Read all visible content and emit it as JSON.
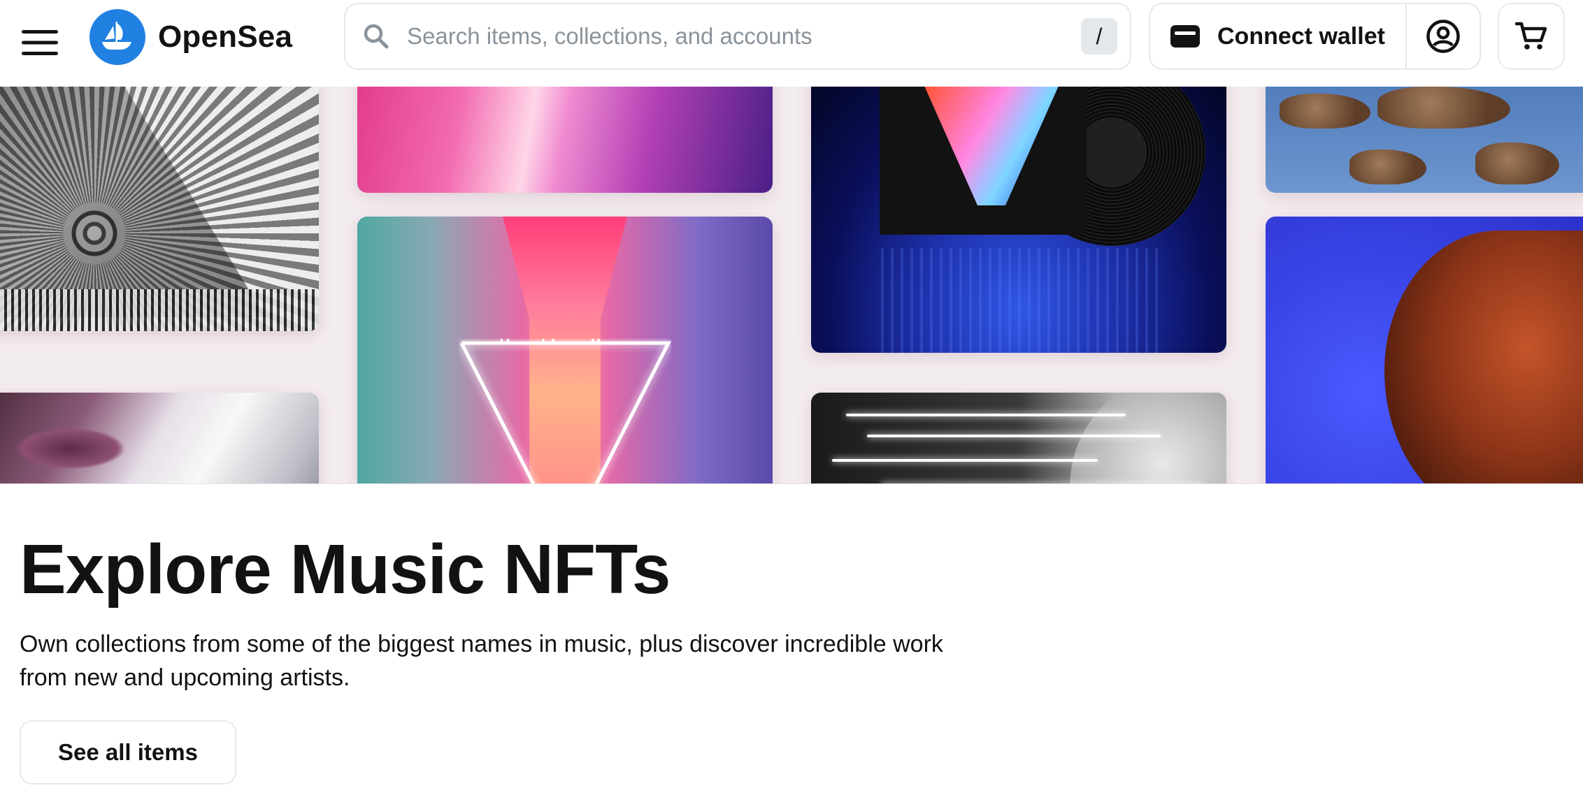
{
  "header": {
    "logo_text": "OpenSea",
    "search": {
      "placeholder": "Search items, collections, and accounts",
      "shortcut_key": "/"
    },
    "connect_wallet_label": "Connect wallet"
  },
  "hero": {
    "title": "Explore Music NFTs",
    "description": "Own collections from some of the biggest names in music, plus discover incredible work from new and upcoming artists.",
    "cta_label": "See all items"
  },
  "colors": {
    "brand_blue": "#2081e2",
    "text_primary": "#121212",
    "text_placeholder": "#8a939b",
    "border": "#e5e8eb"
  },
  "icons": [
    "menu-icon",
    "opensea-logo-icon",
    "search-icon",
    "wallet-icon",
    "account-icon",
    "cart-icon"
  ]
}
